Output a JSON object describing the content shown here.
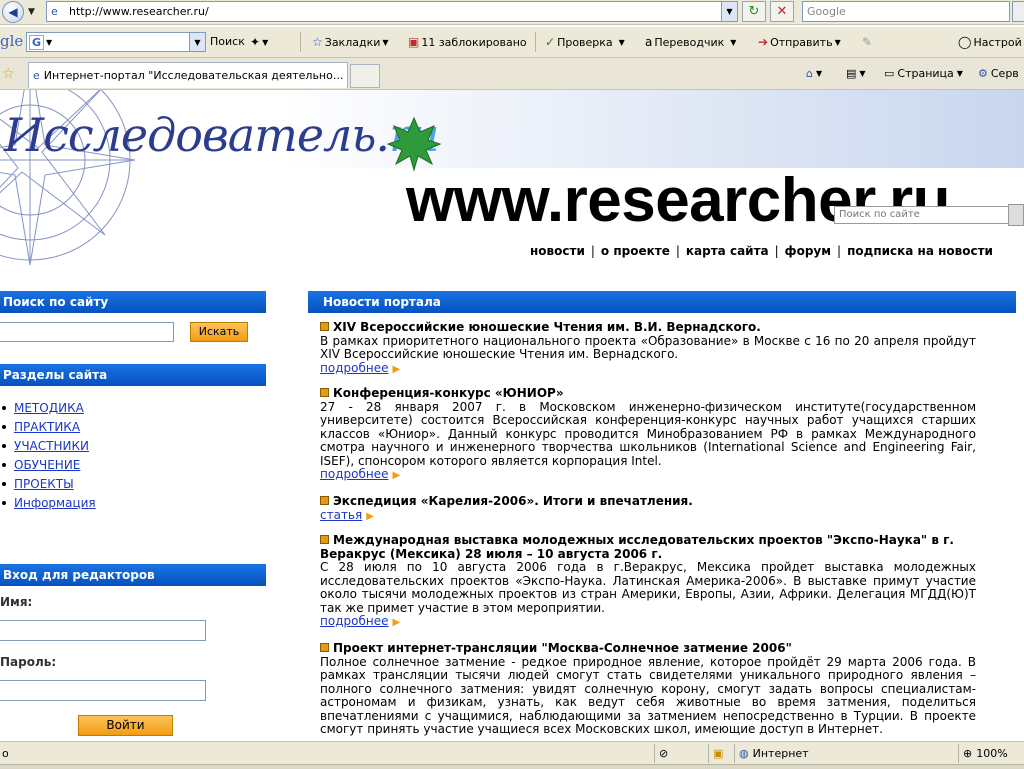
{
  "browser": {
    "address": "http://www.researcher.ru/",
    "search_placeholder": "Google",
    "google_label": "gle",
    "google_letter": "G",
    "toolbar": {
      "search": "Поиск",
      "bookmarks": "Закладки",
      "blocked": "11 заблокировано",
      "spellcheck": "Проверка",
      "translator": "Переводчик",
      "send": "Отправить",
      "settings": "Настрой"
    },
    "tab_title": "Интернет-портал \"Исследовательская деятельно...",
    "commands": {
      "page": "Страница",
      "service": "Серв"
    }
  },
  "header": {
    "logo_main": "Исследователь.",
    "logo_ru": "ru",
    "big_domain": "www.researcher.ru",
    "site_search_placeholder": "Поиск по сайте",
    "nav": [
      "новости",
      "о проекте",
      "карта сайта",
      "форум",
      "подписка на новости"
    ]
  },
  "sidebar": {
    "search_title": "Поиск по сайту",
    "search_button": "Искать",
    "sections_title": "Разделы сайта",
    "sections": [
      "МЕТОДИКА",
      "ПРАКТИКА",
      "УЧАСТНИКИ",
      "ОБУЧЕНИЕ",
      "ПРОЕКТЫ",
      "Информация"
    ],
    "login_title": "Вход для редакторов",
    "name_label": "Имя:",
    "password_label": "Пароль:",
    "login_button": "Войти"
  },
  "news": {
    "title": "Новости портала",
    "items": [
      {
        "title": "XIV Всероссийские юношеские Чтения им. В.И. Вернадского.",
        "body": "В рамках приоритетного национального проекта «Образование» в Москве с 16 по 20 апреля пройдут XIV Всероссийские юношеские Чтения им. Вернадского.",
        "more": "подробнее"
      },
      {
        "title": "Конференция-конкурс «ЮНИОР»",
        "body": "27 - 28 января 2007 г. в Московском инженерно-физическом институте(государственном университете) состоится Всероссийская конференция-конкурс научных работ учащихся старших классов «Юниор». Данный конкурс проводится Минобразованием РФ в рамках Международного смотра научного и инженерного творчества школьников (International Science and Engineering Fair, ISEF), спонсором которого является корпорация Intel.",
        "more": "подробнее"
      },
      {
        "title": "Экспедиция «Карелия-2006». Итоги и впечатления.",
        "body": "",
        "more": "статья"
      },
      {
        "title": "Международная выставка молодежных исследовательских проектов \"Экспо-Наука\" в г. Веракрус (Мексика) 28 июля – 10 августа 2006 г.",
        "body": "С 28 июля по 10 августа 2006 года в г.Веракрус, Мексика пройдет выставка молодежных исследовательских проектов «Экспо-Наука. Латинская Америка-2006». В выставке примут участие около тысячи молодежных проектов из стран Америки, Европы, Азии, Африки. Делегация МГДД(Ю)Т так же примет участие в этом мероприятии.",
        "more": "подробнее"
      },
      {
        "title": "Проект интернет-трансляции \"Москва-Солнечное затмение 2006\"",
        "body": "Полное солнечное затмение - редкое природное явление, которое пройдёт 29 марта 2006 года. В рамках трансляции тысячи людей смогут стать свидетелями уникального природного явления – полного солнечного затмения: увидят солнечную корону, смогут задать вопросы специалистам-астрономам и физикам, узнать, как ведут себя животные во время затмения, поделиться впечатлениями с учащимися, наблюдающими за затмением непосредственно в Турции. В проекте смогут принять участие учащиеся всех Московских школ, имеющие доступ в Интернет.",
        "more": ""
      }
    ]
  },
  "status": {
    "left": "о",
    "zone": "Интернет",
    "zoom": "100%"
  }
}
